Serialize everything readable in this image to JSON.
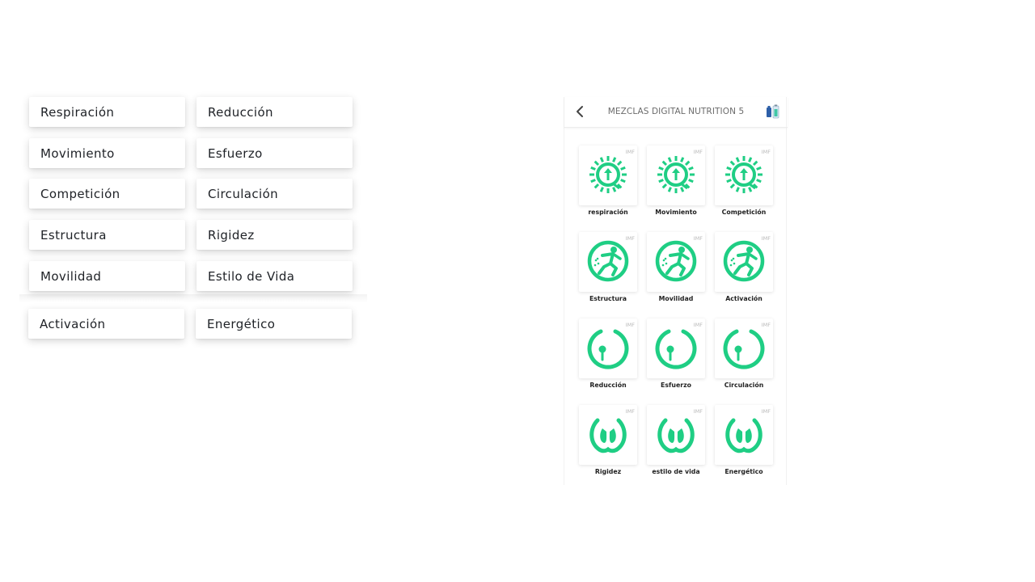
{
  "buttons": [
    {
      "left": "Respiración",
      "right": "Reducción"
    },
    {
      "left": "Movimiento",
      "right": "Esfuerzo"
    },
    {
      "left": "Competición",
      "right": "Circulación"
    },
    {
      "left": "Estructura",
      "right": "Rigidez"
    },
    {
      "left": "Movilidad",
      "right": "Estilo de Vida"
    },
    {
      "left": "Activación",
      "right": "Energético"
    }
  ],
  "phone": {
    "title": "MEZCLAS DIGITAL NUTRITION 5",
    "back_icon": "chevron-left-icon",
    "header_icon": "bottle-icon",
    "accent_color": "#1fce84",
    "badge": "IMF",
    "grid": [
      {
        "label": "respiración",
        "icon": "sun-arrow-icon"
      },
      {
        "label": "Movimiento",
        "icon": "sun-arrow-icon"
      },
      {
        "label": "Competición",
        "icon": "sun-arrow-icon"
      },
      {
        "label": "Estructura",
        "icon": "runner-icon"
      },
      {
        "label": "Movilidad",
        "icon": "runner-icon"
      },
      {
        "label": "Activación",
        "icon": "runner-icon"
      },
      {
        "label": "Reducción",
        "icon": "seed-ring-icon"
      },
      {
        "label": "Esfuerzo",
        "icon": "seed-ring-icon"
      },
      {
        "label": "Circulación",
        "icon": "seed-ring-icon"
      },
      {
        "label": "Rigidez",
        "icon": "lungs-icon"
      },
      {
        "label": "estilo de vida",
        "icon": "lungs-icon"
      },
      {
        "label": "Energético",
        "icon": "lungs-icon"
      }
    ]
  }
}
